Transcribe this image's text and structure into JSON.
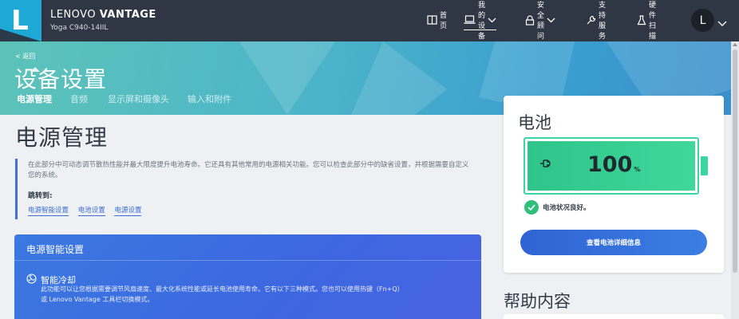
{
  "app": {
    "brand_prefix": "LENOVO ",
    "brand_bold": "VANTAGE",
    "model": "Yoga C940-14IIL",
    "logo_letter": "L"
  },
  "nav": {
    "items": [
      {
        "label": "首页",
        "icon": "home-icon",
        "has_chevron": false,
        "active": false
      },
      {
        "label": "我的设备",
        "icon": "laptop-icon",
        "has_chevron": true,
        "active": true
      },
      {
        "label": "安全顾问",
        "icon": "lock-icon",
        "has_chevron": true,
        "active": false
      },
      {
        "label": "支持服务",
        "icon": "wrench-icon",
        "has_chevron": false,
        "active": false
      },
      {
        "label": "硬件扫描",
        "icon": "flask-icon",
        "has_chevron": false,
        "active": false
      }
    ],
    "avatar_letter": "L"
  },
  "hero": {
    "back_label": "< 返回",
    "title": "设备设置",
    "tabs": [
      {
        "label": "电源管理",
        "active": true
      },
      {
        "label": "音频",
        "active": false
      },
      {
        "label": "显示屏和摄像头",
        "active": false
      },
      {
        "label": "输入和附件",
        "active": false
      }
    ]
  },
  "main": {
    "section_title": "电源管理",
    "description": "在此部分中可动态调节散热性能并最大限度提升电池寿命。它还具有其他常用的电源相关功能。您可以检查此部分中的缺省设置，并根据需要自定义您的系统。",
    "jump_label": "跳转到:",
    "jump_links": [
      "电源智能设置",
      "电池设置",
      "电源设置"
    ]
  },
  "smart_card": {
    "header": "电源智能设置",
    "cooling_title": "智能冷却",
    "cooling_desc_line1": "此功能可以让您根据需要调节风扇速度、最大化系统性能或延长电池使用寿命。它有以下三种模式。您也可以使用热键（Fn+Q）",
    "cooling_desc_line2": "或 Lenovo Vantage 工具栏切换模式。"
  },
  "battery": {
    "title": "电池",
    "level": "100",
    "unit": "%",
    "level_fraction": 1.0,
    "health_text": "电池状况良好。",
    "details_button": "查看电池详细信息"
  },
  "help": {
    "title": "帮助内容"
  },
  "colors": {
    "topbar": "#2f3744",
    "accent_blue": "#3a74d8",
    "battery_green": "#3ad6a0",
    "health_green": "#2fbf7a"
  }
}
